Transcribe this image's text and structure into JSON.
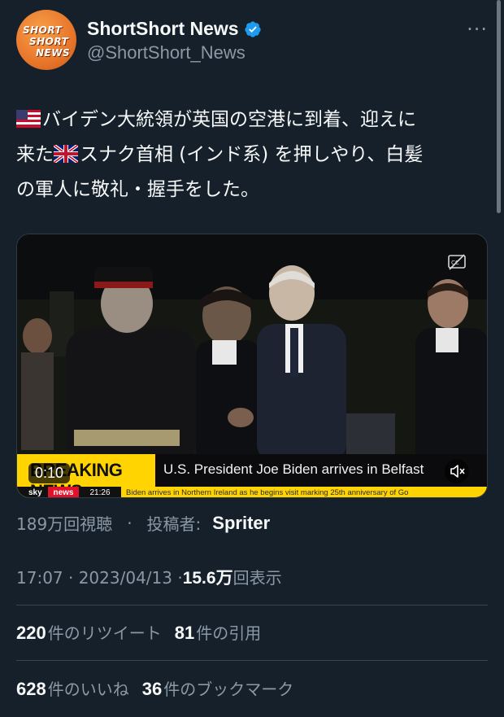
{
  "account": {
    "name": "ShortShort News",
    "handle": "@ShortShort_News",
    "avatar_lines": [
      "SHORT",
      "SHORT",
      "NEWS"
    ],
    "verified_icon": "verified-badge-icon",
    "more_label": "···"
  },
  "tweet": {
    "line1_text": "バイデン大統領が英国の空港に到着、迎えに",
    "line2_pre": "来た",
    "line2_post": "スナク首相 (インド系) を押しやり、白髪",
    "line3": "の軍人に敬礼・握手をした。",
    "flag_us": "us-flag-icon",
    "flag_uk": "uk-flag-icon"
  },
  "video": {
    "timestamp": "0:10",
    "ticker_left": "BREAKING NEWS",
    "ticker_right": "U.S. President Joe Biden arrives in Belfast",
    "strap_brand_sky": "sky",
    "strap_brand_news": "news",
    "strap_clock": "21:26",
    "strap_crawl": "Biden arrives in Northern Ireland as he begins visit marking 25th anniversary of Go"
  },
  "views": {
    "count": "189万回視聴",
    "separator": "·",
    "author_label": "投稿者:",
    "author": "Spriter"
  },
  "meta": {
    "time": "17:07 · 2023/04/13 · ",
    "impressions": "15.6万",
    "impressions_label": "回表示"
  },
  "stats": {
    "retweets": "220",
    "retweets_label": "件のリツイート",
    "quotes": "81",
    "quotes_label": "件の引用",
    "likes": "628",
    "likes_label": "件のいいね",
    "bookmarks": "36",
    "bookmarks_label": "件のブックマーク"
  },
  "colors": {
    "background": "#15202b",
    "text": "#f7f9f9",
    "muted": "#8b98a5",
    "verified": "#1d9bf0",
    "breaking_yellow": "#ffd400"
  }
}
